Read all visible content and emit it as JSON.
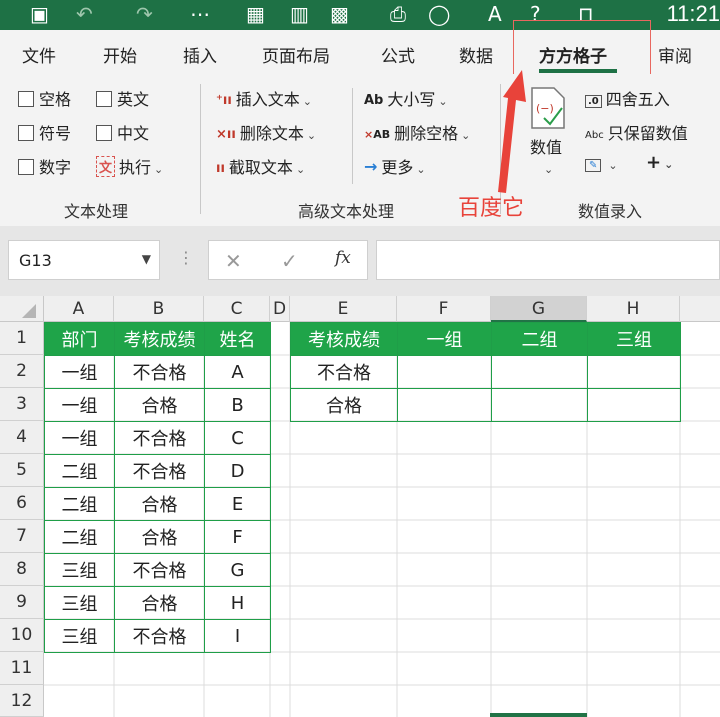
{
  "titlebar": {
    "clock": "11:21"
  },
  "tabs": [
    {
      "label": "文件"
    },
    {
      "label": "开始"
    },
    {
      "label": "插入"
    },
    {
      "label": "页面布局"
    },
    {
      "label": "公式"
    },
    {
      "label": "数据"
    },
    {
      "label": "方方格子"
    },
    {
      "label": "审阅"
    }
  ],
  "ribbon": {
    "text_group": {
      "checkboxes": [
        "空格",
        "英文",
        "符号",
        "中文",
        "数字"
      ],
      "execute": "执行",
      "label": "文本处理"
    },
    "advanced_group": {
      "insert_text": "插入文本",
      "delete_text": "删除文本",
      "extract_text": "截取文本",
      "case": "大小写",
      "delete_space": "删除空格",
      "more": "更多",
      "label": "高级文本处理"
    },
    "value_group": {
      "value_btn": "数值",
      "round": "四舍五入",
      "keep_value": "只保留数值",
      "label": "数值录入"
    }
  },
  "annotation": "百度它",
  "formula_bar": {
    "name_box": "G13",
    "fx": "fx",
    "value": ""
  },
  "columns": [
    "A",
    "B",
    "C",
    "D",
    "E",
    "F",
    "G",
    "H"
  ],
  "rows": [
    "1",
    "2",
    "3",
    "4",
    "5",
    "6",
    "7",
    "8",
    "9",
    "10",
    "11",
    "12"
  ],
  "table1": {
    "headers": [
      "部门",
      "考核成绩",
      "姓名"
    ],
    "rows": [
      [
        "一组",
        "不合格",
        "A"
      ],
      [
        "一组",
        "合格",
        "B"
      ],
      [
        "一组",
        "不合格",
        "C"
      ],
      [
        "二组",
        "不合格",
        "D"
      ],
      [
        "二组",
        "合格",
        "E"
      ],
      [
        "二组",
        "合格",
        "F"
      ],
      [
        "三组",
        "不合格",
        "G"
      ],
      [
        "三组",
        "合格",
        "H"
      ],
      [
        "三组",
        "不合格",
        "I"
      ]
    ]
  },
  "table2": {
    "headers": [
      "考核成绩",
      "一组",
      "二组",
      "三组"
    ],
    "rows": [
      [
        "不合格",
        "",
        "",
        ""
      ],
      [
        "合格",
        "",
        "",
        ""
      ]
    ]
  },
  "colors": {
    "header_green": "#1fa449",
    "excel_green": "#1e7145",
    "annotation_red": "#e8433a"
  }
}
